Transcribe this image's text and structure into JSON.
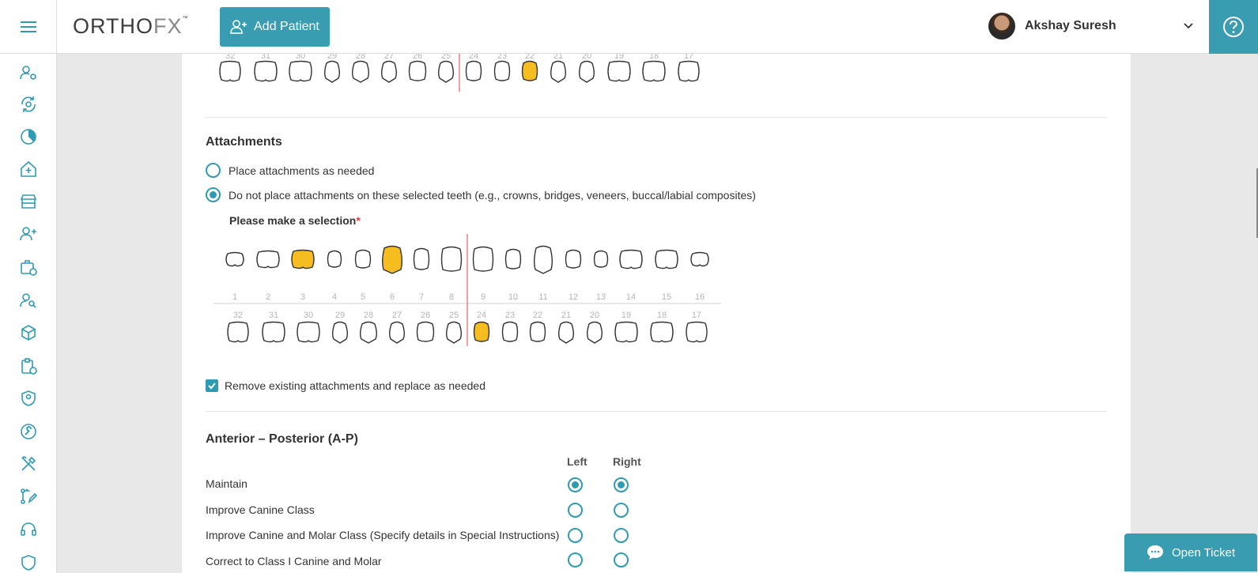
{
  "brand": {
    "logo_main": "ORTHO",
    "logo_fx": "FX",
    "logo_tm": "™"
  },
  "header": {
    "add_patient_label": "Add Patient",
    "user_name": "Akshay Suresh"
  },
  "colors": {
    "accent": "#3a9cb0",
    "selected_tooth": "#f5bd1f",
    "midline": "#f08080"
  },
  "sidebar": {
    "icons": [
      "user-gear-icon",
      "refresh-gear-icon",
      "pie-chart-icon",
      "clinic-icon",
      "store-icon",
      "add-user-icon",
      "briefcase-clock-icon",
      "user-search-icon",
      "cube-icon",
      "clipboard-clock-icon",
      "shield-user-icon",
      "wrench-circle-icon",
      "tools-icon",
      "workflow-edit-icon",
      "headset-icon",
      "shield-icon"
    ]
  },
  "top_chart": {
    "numbers": [
      "32",
      "31",
      "30",
      "29",
      "28",
      "27",
      "26",
      "25",
      "24",
      "23",
      "22",
      "21",
      "20",
      "19",
      "18",
      "17"
    ],
    "selected": [
      "22"
    ]
  },
  "attachments": {
    "title": "Attachments",
    "option_1": "Place attachments as needed",
    "option_2": "Do not place attachments on these selected teeth (e.g., crowns, bridges, veneers, buccal/labial composites)",
    "selected_option": "option_2",
    "selection_label": "Please make a selection",
    "required_mark": "*",
    "upper_numbers": [
      "1",
      "2",
      "3",
      "4",
      "5",
      "6",
      "7",
      "8",
      "9",
      "10",
      "11",
      "12",
      "13",
      "14",
      "15",
      "16"
    ],
    "lower_numbers": [
      "32",
      "31",
      "30",
      "29",
      "28",
      "27",
      "26",
      "25",
      "24",
      "23",
      "22",
      "21",
      "20",
      "19",
      "18",
      "17"
    ],
    "selected_teeth": [
      "3",
      "6",
      "24"
    ],
    "remove_label": "Remove existing attachments and replace as needed",
    "remove_checked": true
  },
  "ap": {
    "title": "Anterior – Posterior (A-P)",
    "col_left": "Left",
    "col_right": "Right",
    "rows": [
      {
        "label": "Maintain",
        "left": true,
        "right": true
      },
      {
        "label": "Improve Canine Class",
        "left": false,
        "right": false
      },
      {
        "label": "Improve Canine and Molar Class (Specify details in Special Instructions)",
        "left": false,
        "right": false
      },
      {
        "label": "Correct to Class I Canine and Molar",
        "left": false,
        "right": false
      }
    ]
  },
  "open_ticket": "Open Ticket"
}
